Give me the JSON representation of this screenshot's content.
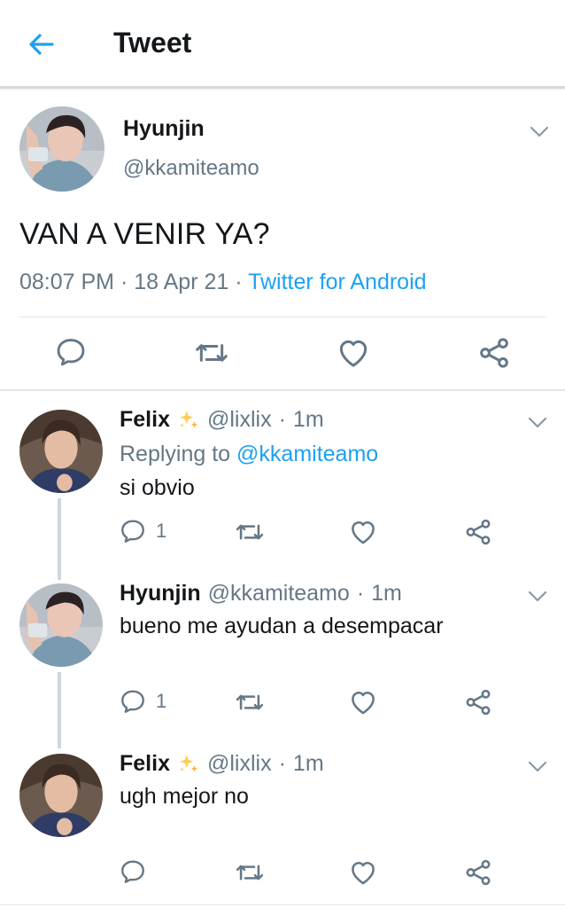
{
  "header": {
    "title": "Tweet"
  },
  "main_tweet": {
    "name": "Hyunjin",
    "handle": "@kkamiteamo",
    "text": "VAN A VENIR YA?",
    "time": "08:07 PM",
    "date": "18 Apr 21",
    "source": "Twitter for Android",
    "sep": "·"
  },
  "replies": [
    {
      "name": "Felix",
      "emoji": "✨",
      "handle": "@lixlix",
      "time": "1m",
      "replying_prefix": "Replying to",
      "replying_to": "@kkamiteamo",
      "text": "si obvio",
      "reply_count": "1"
    },
    {
      "name": "Hyunjin",
      "handle": "@kkamiteamo",
      "time": "1m",
      "text": "bueno me ayudan a desempacar",
      "reply_count": "1"
    },
    {
      "name": "Felix",
      "emoji": "✨",
      "handle": "@lixlix",
      "time": "1m",
      "text": "ugh mejor no"
    }
  ],
  "colors": {
    "accent": "#1da1f2",
    "secondary_text": "#657786",
    "divider": "#e1e8ed"
  },
  "icons": [
    "back-arrow-icon",
    "chevron-down-icon",
    "reply-icon",
    "retweet-icon",
    "like-icon",
    "share-icon",
    "sparkles-icon"
  ]
}
